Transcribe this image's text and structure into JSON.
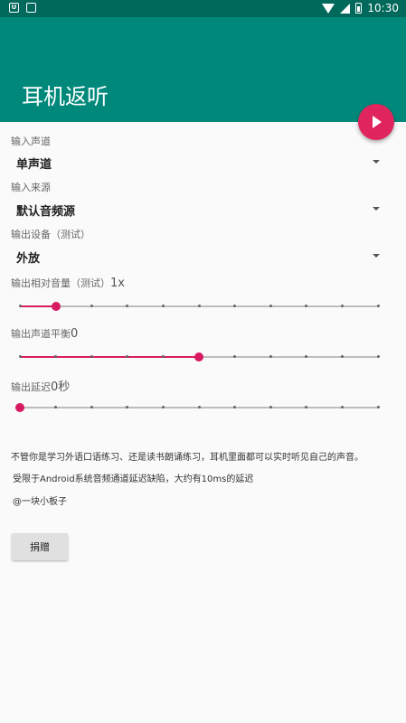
{
  "status_bar": {
    "time": "10:30",
    "notif_icon_1": "notification-icon",
    "notif_icon_2": "notification-icon"
  },
  "app_bar": {
    "title": "耳机返听"
  },
  "fab": {
    "icon": "play-icon"
  },
  "input_channel": {
    "label": "输入声道",
    "value": "单声道"
  },
  "input_source": {
    "label": "输入来源",
    "value": "默认音频源"
  },
  "output_device": {
    "label": "输出设备（测试）",
    "value": "外放"
  },
  "volume": {
    "label": "输出相对音量（测试）",
    "value": "1x",
    "position": 0.1,
    "ticks": 11
  },
  "balance": {
    "label": "输出声道平衡",
    "value": "0",
    "position": 0.5,
    "ticks": 11
  },
  "delay": {
    "label": "输出延迟",
    "value": "0秒",
    "position": 0.0,
    "ticks": 11
  },
  "info": {
    "line1": "不管你是学习外语口语练习、还是读书朗诵练习，耳机里面都可以实时听见自己的声音。",
    "line2": "受限于Android系统音频通道延迟缺陷，大约有10ms的延迟",
    "line3": "@一块小板子"
  },
  "donate_button": {
    "label": "捐赠"
  },
  "colors": {
    "primary": "#00897b",
    "primary_dark": "#00695c",
    "accent": "#d81b60"
  }
}
